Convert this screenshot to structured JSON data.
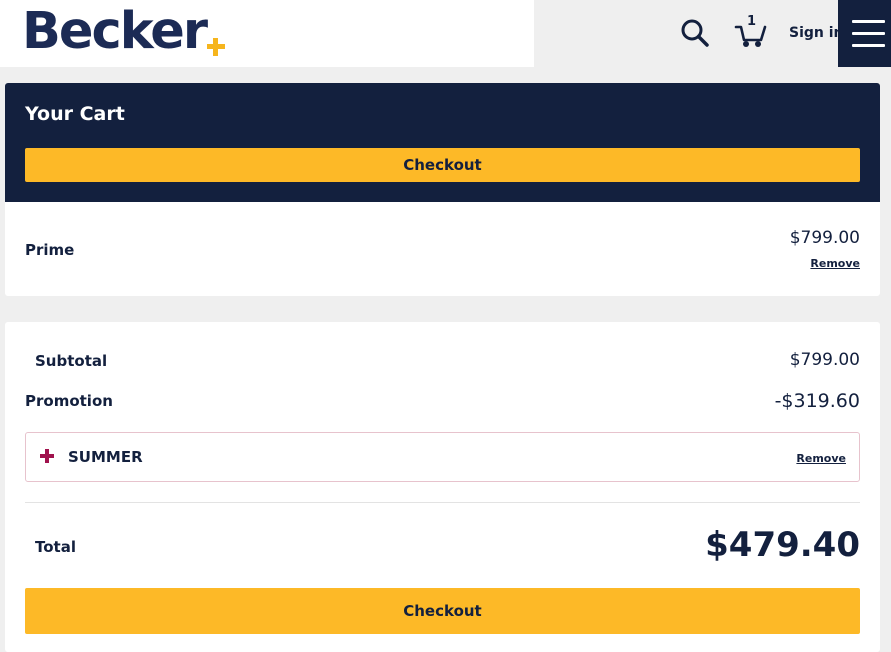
{
  "header": {
    "logo_text": "Becker",
    "cart_count": "1",
    "signin_label": "Sign in",
    "accent_color": "#fdb927",
    "navy_color": "#13203e",
    "icons": [
      "search-icon",
      "cart-icon",
      "menu-icon"
    ]
  },
  "cart": {
    "title": "Your Cart",
    "checkout_label": "Checkout",
    "items": [
      {
        "name": "Prime",
        "price": "$799.00",
        "remove_label": "Remove"
      }
    ]
  },
  "summary": {
    "subtotal_label": "Subtotal",
    "subtotal_value": "$799.00",
    "promotion_label": "Promotion",
    "promotion_value": "-$319.60",
    "promo_code": "SUMMER",
    "promo_remove_label": "Remove",
    "total_label": "Total",
    "total_value": "$479.40",
    "checkout_label": "Checkout"
  }
}
